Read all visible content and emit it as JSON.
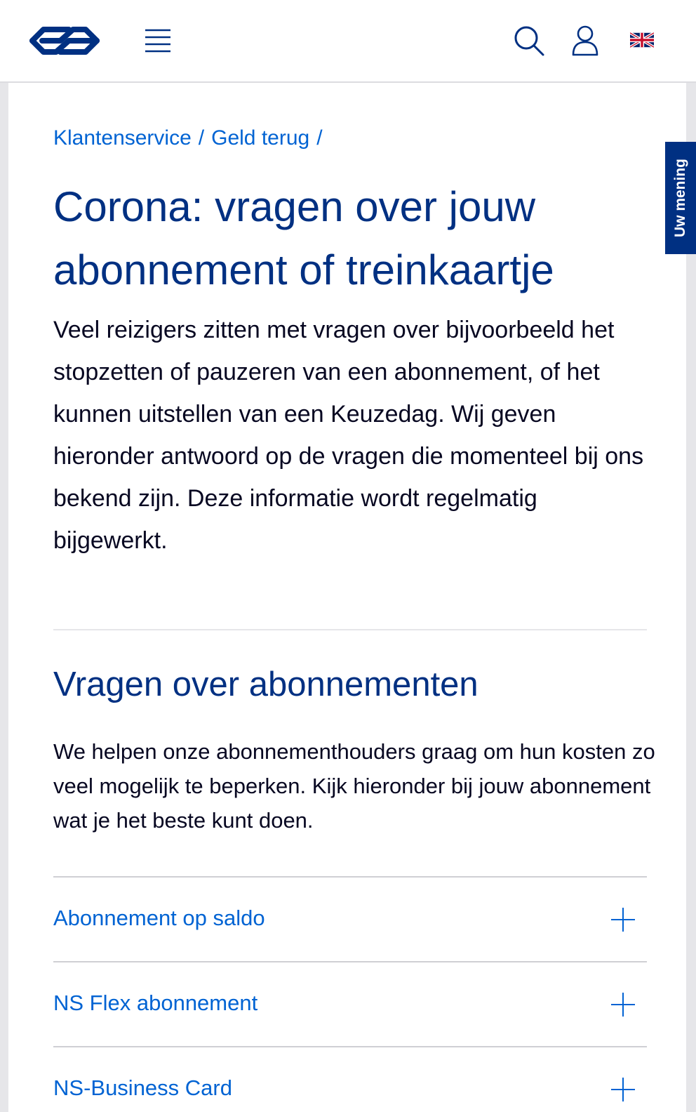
{
  "header": {
    "logo_icon": "ns-logo-icon",
    "menu_icon": "hamburger-menu-icon",
    "search_icon": "search-icon",
    "account_icon": "user-icon",
    "language_icon": "uk-flag-icon"
  },
  "breadcrumb": {
    "items": [
      "Klantenservice",
      "Geld terug"
    ],
    "separator": "/"
  },
  "page": {
    "title": "Corona: vragen over jouw abonnement of treinkaartje",
    "intro": "Veel reizigers zitten met vragen over bijvoorbeeld het stopzetten of pauzeren van een abonnement, of het kunnen uitstellen van een Keuzedag. Wij geven hieronder antwoord op de vragen die momenteel bij ons bekend zijn. Deze informatie wordt regelmatig bijgewerkt."
  },
  "section": {
    "title": "Vragen over abonnementen",
    "body": "We helpen onze abonnementhouders graag om hun kosten zo veel mogelijk te beperken. Kijk hieronder bij jouw abonnement wat je het beste kunt doen.",
    "accordion": [
      {
        "label": "Abonnement op saldo",
        "icon": "plus-icon"
      },
      {
        "label": "NS Flex abonnement",
        "icon": "plus-icon"
      },
      {
        "label": "NS-Business Card",
        "icon": "plus-icon"
      }
    ]
  },
  "feedback": {
    "label": "Uw mening"
  },
  "colors": {
    "brand_blue": "#003082",
    "link_blue": "#0063d3",
    "text": "#070721",
    "page_bg": "#e6e6e9"
  }
}
